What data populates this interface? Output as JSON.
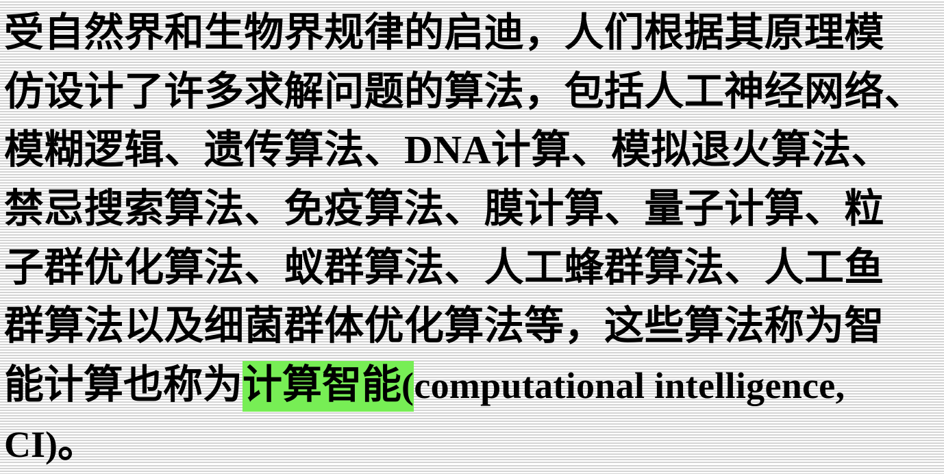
{
  "paragraph": {
    "line1": "受自然界和生物界规律的启迪，人们根据其原理模",
    "line2": "仿设计了许多求解问题的算法，包括人工神经网络、",
    "line3_a": "模糊逻辑、遗传算法、",
    "line3_latin": "DNA",
    "line3_b": "计算、模拟退火算法、",
    "line4": "禁忌搜索算法、免疫算法、膜计算、量子计算、粒",
    "line5": "子群优化算法、蚁群算法、人工蜂群算法、人工鱼",
    "line6": "群算法以及细菌群体优化算法等，这些算法称为智",
    "line7_prefix": "能计算也称为",
    "line7_highlight": "计算智能",
    "line7_paren": "(",
    "line7_latin": "computational intelligence,",
    "line8_latin": "CI)",
    "line8_end": "。"
  },
  "colors": {
    "highlight": "#77ee55",
    "text": "#000000",
    "stripe": "#d4d4d4"
  }
}
